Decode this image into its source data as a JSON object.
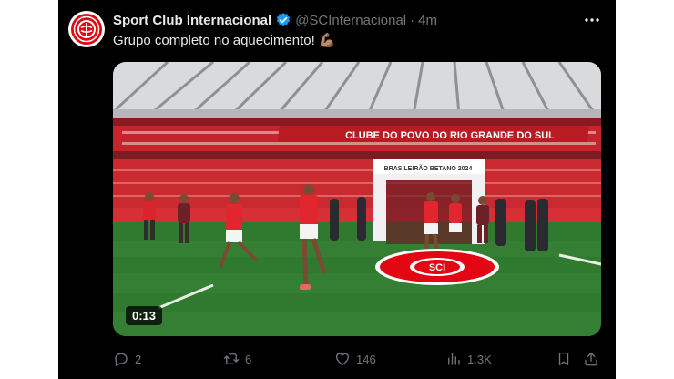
{
  "tweet": {
    "display_name": "Sport Club Internacional",
    "handle": "@SCInternacional",
    "separator": "·",
    "time": "4m",
    "text": "Grupo completo no aquecimento!",
    "emoji": "💪🏽",
    "media": {
      "duration": "0:13",
      "tunnel_banner": "BRASILEIRÃO BETANO 2024",
      "stand_banner": "CLUBE DO POVO DO RIO GRANDE DO SUL",
      "center_logo": "SCI"
    },
    "actions": {
      "replies": "2",
      "reposts": "6",
      "likes": "146",
      "views": "1.3K"
    }
  },
  "icons": {
    "avatar": "sci-crest-icon",
    "verified": "verified-badge-icon",
    "more": "more-icon",
    "reply": "reply-icon",
    "repost": "repost-icon",
    "like": "heart-icon",
    "views": "views-icon",
    "bookmark": "bookmark-icon",
    "share": "share-icon"
  },
  "colors": {
    "background": "#000000",
    "text": "#e7e9ea",
    "muted": "#71767b",
    "verified": "#1d9bf0",
    "club_red": "#e30613"
  }
}
